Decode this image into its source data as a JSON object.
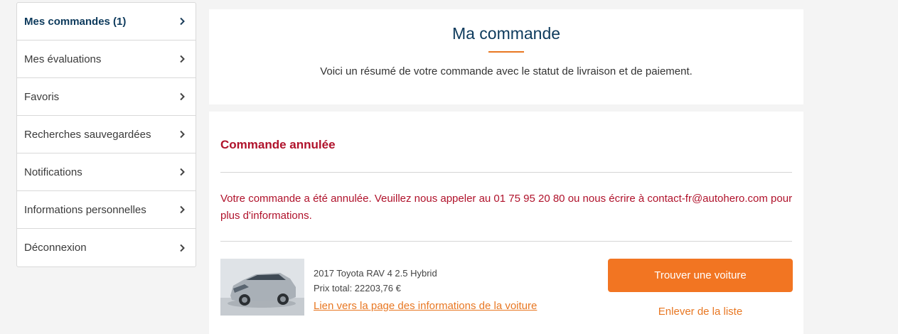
{
  "sidebar": {
    "items": [
      {
        "label": "Mes commandes (1)",
        "active": true
      },
      {
        "label": "Mes évaluations"
      },
      {
        "label": "Favoris"
      },
      {
        "label": "Recherches sauvegardées"
      },
      {
        "label": "Notifications"
      },
      {
        "label": "Informations personnelles"
      },
      {
        "label": "Déconnexion"
      }
    ]
  },
  "header": {
    "title": "Ma commande",
    "summary": "Voici un résumé de votre commande avec le statut de livraison et de paiement."
  },
  "order": {
    "status_title": "Commande annulée",
    "message": "Votre commande a été annulée. Veuillez nous appeler au 01 75 95 20 80 ou nous écrire à contact-fr@autohero.com pour plus d'informations.",
    "car_name": "2017 Toyota RAV 4 2.5 Hybrid",
    "price": "Prix total: 22203,76 €",
    "car_link": "Lien vers la page des informations de la voiture",
    "find_button": "Trouver une voiture",
    "remove_link": "Enlever de la liste"
  },
  "colors": {
    "accent": "#f27522",
    "navy": "#0d3a5c",
    "error": "#b0122b"
  }
}
